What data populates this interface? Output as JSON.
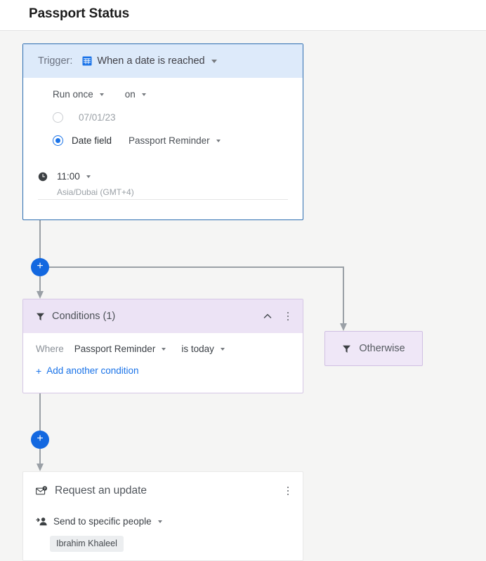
{
  "header": {
    "title": "Passport Status"
  },
  "trigger": {
    "label": "Trigger:",
    "icon": "calendar-grid-icon",
    "value": "When a date is reached",
    "frequency": "Run once",
    "preposition": "on",
    "date_option": {
      "selected": false,
      "value": "07/01/23"
    },
    "date_field_option": {
      "selected": true,
      "label": "Date field",
      "field": "Passport Reminder"
    },
    "time": "11:00",
    "timezone": "Asia/Dubai (GMT+4)"
  },
  "add_step_buttons": {
    "label": "+"
  },
  "conditions": {
    "icon": "funnel-icon",
    "title": "Conditions (1)",
    "collapse_icon": "chevron-up-icon",
    "menu_icon": "kebab-menu-icon",
    "where_label": "Where",
    "field": "Passport Reminder",
    "operator": "is today",
    "add_another": "Add another condition",
    "add_another_plus": "+"
  },
  "otherwise": {
    "icon": "funnel-icon",
    "label": "Otherwise"
  },
  "action": {
    "icon": "mail-question-icon",
    "title": "Request an update",
    "menu_icon": "kebab-menu-icon",
    "recipient_icon": "add-person-icon",
    "recipient_mode": "Send to specific people",
    "recipients": [
      "Ibrahim Khaleel"
    ]
  },
  "colors": {
    "accent_blue": "#1368e0",
    "trigger_header_bg": "#ddeafa",
    "trigger_border": "#2b6cb0",
    "condition_header_bg": "#ece3f5",
    "condition_border": "#d5c6e5",
    "otherwise_bg": "#efe7f7",
    "canvas_bg": "#f5f5f4",
    "connector": "#9aa0a6"
  }
}
